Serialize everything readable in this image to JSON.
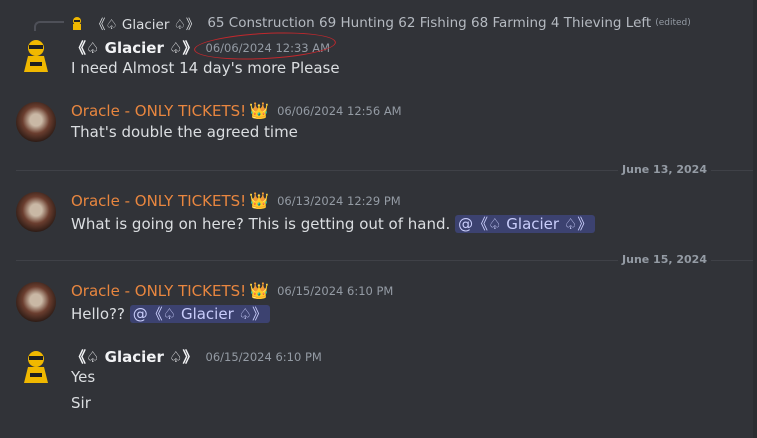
{
  "reply": {
    "author": "《♤ Glacier ♤》",
    "text": "65 Construction 69 Hunting 62 Fishing  68 Farming  4 Thieving Left",
    "edited": "(edited)"
  },
  "messages": [
    {
      "author": "《♤ Glacier ♤》",
      "timestamp": "06/06/2024 12:33 AM",
      "lines": [
        "I need Almost 14 day's more Please"
      ]
    },
    {
      "author": "Oracle - ONLY TICKETS!",
      "badge": "👑",
      "timestamp": "06/06/2024 12:56 AM",
      "lines": [
        "That's double the agreed time"
      ]
    },
    {
      "divider": "June 13, 2024"
    },
    {
      "author": "Oracle - ONLY TICKETS!",
      "badge": "👑",
      "timestamp": "06/13/2024 12:29 PM",
      "lines": [
        "What is going on here? This is getting out of hand."
      ],
      "mention": "@《♤ Glacier ♤》"
    },
    {
      "divider": "June 15, 2024"
    },
    {
      "author": "Oracle - ONLY TICKETS!",
      "badge": "👑",
      "timestamp": "06/15/2024 6:10 PM",
      "lines": [
        "Hello??"
      ],
      "mention": "@《♤ Glacier ♤》"
    },
    {
      "author": "《♤ Glacier ♤》",
      "timestamp": "06/15/2024 6:10 PM",
      "lines": [
        "Yes",
        "Sir"
      ]
    }
  ],
  "colors": {
    "background": "#313338",
    "oracle_name": "#e8863f",
    "mention_bg": "#3c4270",
    "annotation_circle": "#c0282d"
  }
}
